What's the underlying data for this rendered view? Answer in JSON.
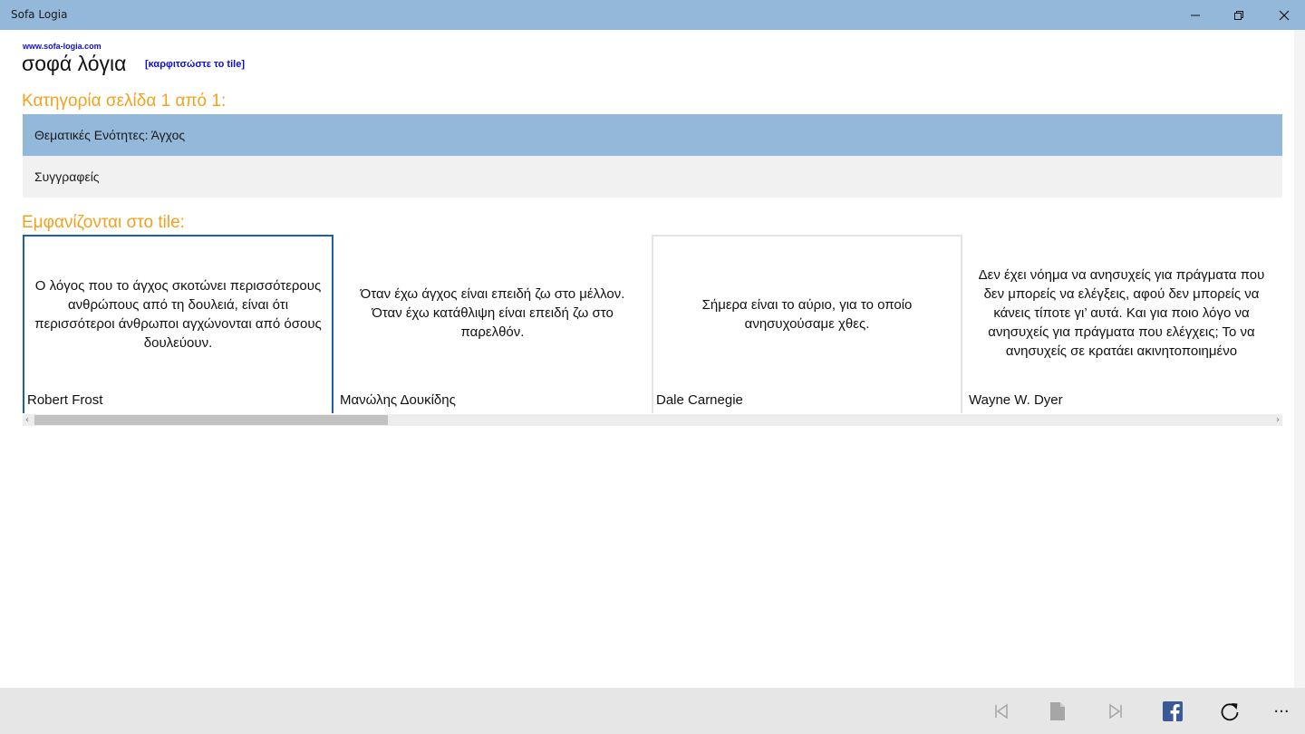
{
  "window": {
    "title": "Sofa Logia"
  },
  "header": {
    "site_url": "www.sofa-logia.com",
    "app_name": "σοφά λόγια",
    "pin_link": "[καρφιτσώστε το tile]"
  },
  "categories": {
    "title": "Κατηγορία σελίδα 1 από 1:",
    "items": [
      {
        "label": "Θεματικές Ενότητες: Άγχος",
        "selected": true
      },
      {
        "label": "Συγγραφείς",
        "selected": false
      }
    ]
  },
  "tiles": {
    "title": "Εμφανίζονται στο tile:",
    "items": [
      {
        "quote": "Ο λόγος που το άγχος σκοτώνει περισσότερους ανθρώπους από τη δουλειά, είναι ότι περισσότεροι άνθρωποι αγχώνονται από όσους δουλεύουν.",
        "author": "Robert Frost"
      },
      {
        "quote": "Όταν έχω άγχος είναι επειδή ζω στο μέλλον. Όταν έχω κατάθλιψη είναι επειδή ζω στο παρελθόν.",
        "author": "Μανώλης Δουκίδης"
      },
      {
        "quote": "Σήμερα είναι το αύριο, για το οποίο ανησυχούσαμε χθες.",
        "author": "Dale Carnegie"
      },
      {
        "quote": "Δεν έχει νόημα να ανησυχείς για πράγματα που δεν μπορείς να ελέγξεις, αφού δεν μπορείς να κάνεις τίποτε γι’ αυτά. Και για ποιο λόγο να ανησυχείς για πράγματα που ελέγχεις; Το να ανησυχείς σε κρατάει ακινητοποιημένο",
        "author": "Wayne W. Dyer"
      }
    ]
  },
  "appbar": {
    "icons": [
      "first-page-icon",
      "page-icon",
      "last-page-icon",
      "facebook-icon",
      "refresh-icon",
      "more-icon"
    ],
    "more_label": "···"
  },
  "colors": {
    "titlebar": "#93b8da",
    "section_title": "#f3a11d",
    "link": "#1010d0",
    "selected_row": "#93b8da",
    "facebook": "#3b5998"
  }
}
